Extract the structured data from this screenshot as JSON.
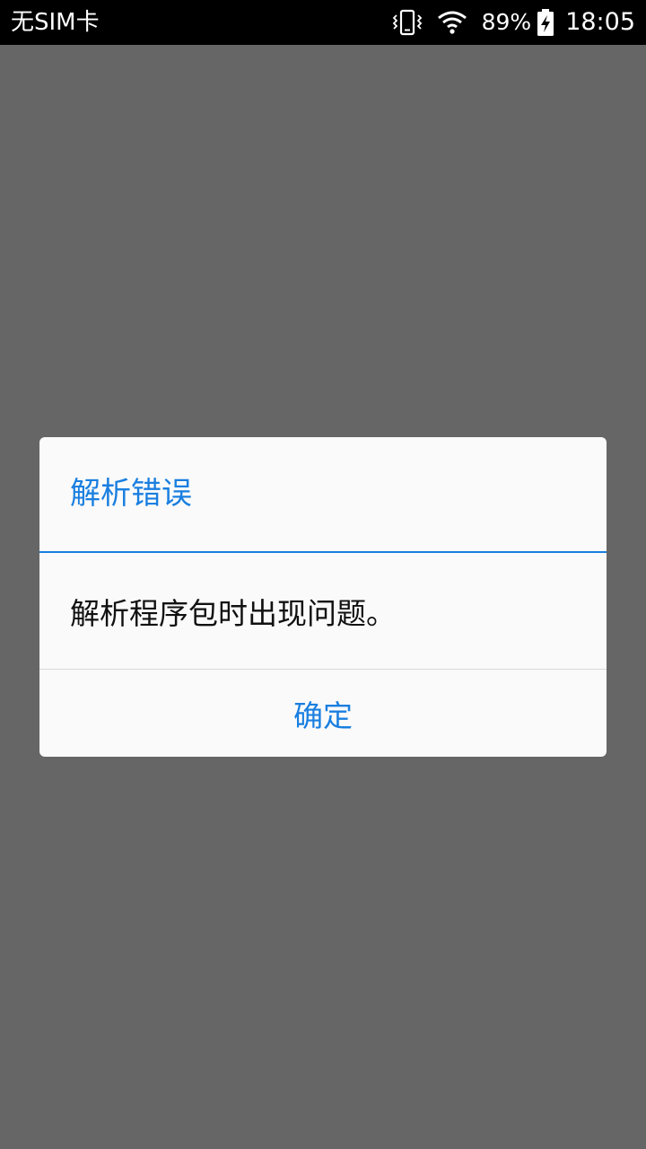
{
  "status_bar": {
    "carrier": "无SIM卡",
    "battery_percent": "89%",
    "time": "18:05",
    "icons": [
      "vibrate-icon",
      "wifi-icon",
      "battery-charging-icon"
    ]
  },
  "dialog": {
    "title": "解析错误",
    "message": "解析程序包时出现问题。",
    "ok_label": "确定"
  },
  "colors": {
    "accent": "#1a7fe0",
    "scrim": "#666666",
    "status_bar_bg": "#000000",
    "dialog_bg": "#fafafa"
  }
}
